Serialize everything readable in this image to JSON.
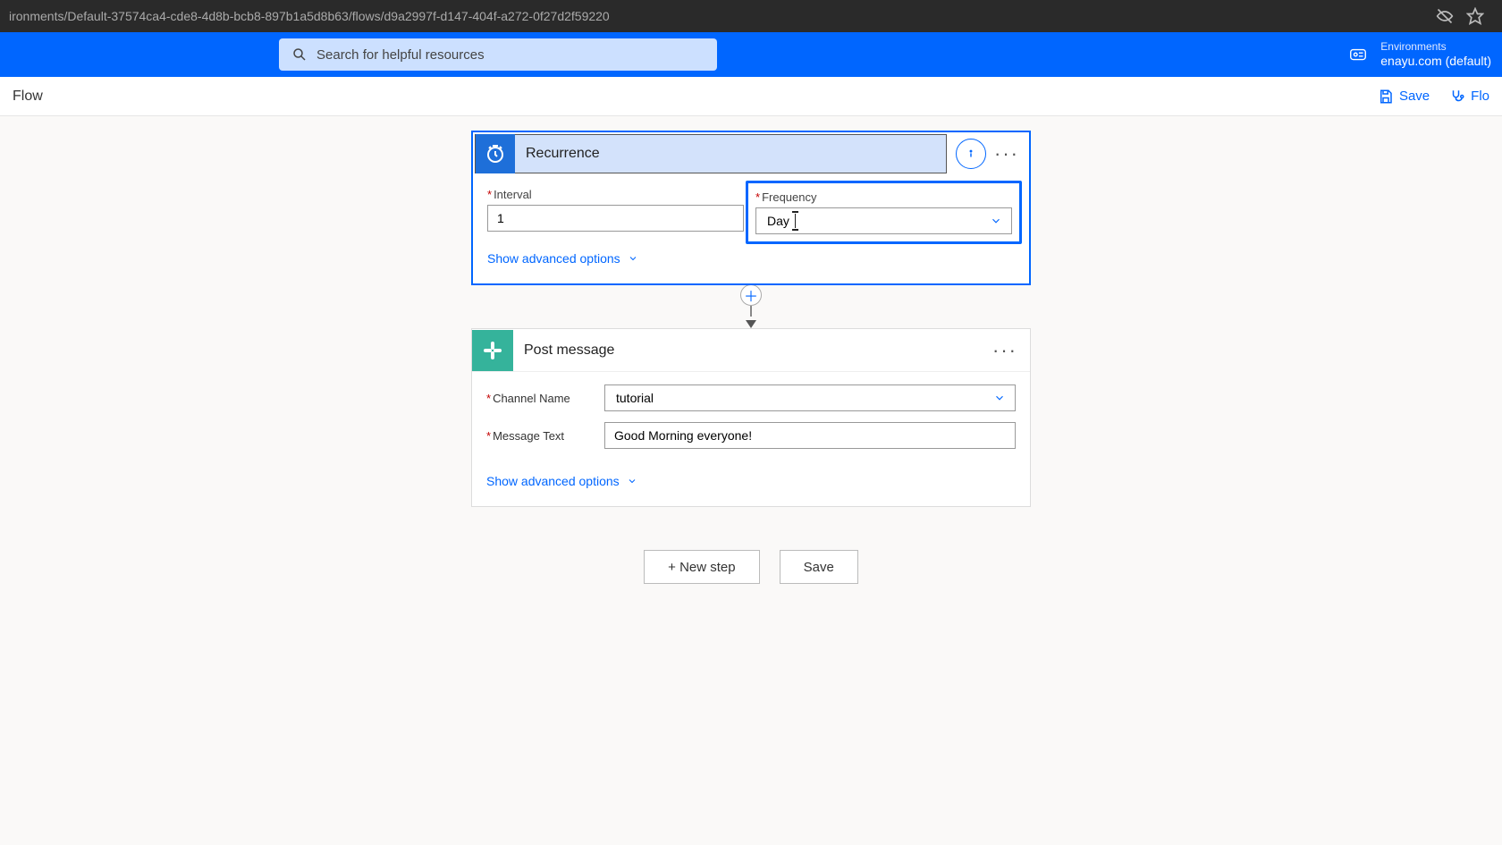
{
  "browser": {
    "url": "ironments/Default-37574ca4-cde8-4d8b-bcb8-897b1a5d8b63/flows/d9a2997f-d147-404f-a272-0f27d2f59220"
  },
  "header": {
    "search_placeholder": "Search for helpful resources",
    "env_label": "Environments",
    "env_value": "enayu.com (default)"
  },
  "cmdbar": {
    "left": "Flow",
    "save": "Save",
    "flo": "Flo"
  },
  "recurrence": {
    "title": "Recurrence",
    "interval_label": "Interval",
    "interval_value": "1",
    "frequency_label": "Frequency",
    "frequency_value": "Day",
    "advanced": "Show advanced options"
  },
  "post": {
    "title": "Post message",
    "channel_label": "Channel Name",
    "channel_value": "tutorial",
    "message_label": "Message Text",
    "message_value": "Good Morning everyone!",
    "advanced": "Show advanced options"
  },
  "buttons": {
    "new_step": "+ New step",
    "save": "Save"
  }
}
